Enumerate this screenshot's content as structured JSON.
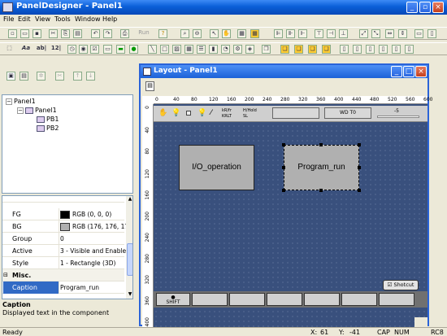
{
  "app": {
    "title": "PanelDesigner - Panel1"
  },
  "menu": [
    "File",
    "Edit",
    "View",
    "Tools",
    "Window",
    "Help"
  ],
  "toolbar": {
    "run_label": "Run",
    "text_a": "Aa",
    "text_ab": "ab|",
    "text_12": "12|"
  },
  "left_toolbar": {},
  "tree": {
    "root": "Panel1",
    "panel": "Panel1",
    "items": [
      "PB1",
      "PB2"
    ]
  },
  "props": {
    "rows": [
      {
        "key": "FG",
        "value": "RGB (0, 0, 0)",
        "color": "#000000"
      },
      {
        "key": "BG",
        "value": "RGB (176, 176, 176)",
        "color": "#b0b0b0"
      },
      {
        "key": "Group",
        "value": "0"
      },
      {
        "key": "Active",
        "value": "3 - Visible and Enabled"
      },
      {
        "key": "Style",
        "value": "1 - Rectangle (3D)"
      }
    ],
    "section": "Misc.",
    "selected": {
      "key": "Caption",
      "value": "Program_run"
    }
  },
  "help": {
    "title": "Caption",
    "text": "Displayed text in the component"
  },
  "status": {
    "ready": "Ready",
    "x": "X:",
    "x_val": "61",
    "y": "Y:",
    "y_val": "-41",
    "caps": "CAP",
    "num": "NUM",
    "rc": "RC8"
  },
  "layout": {
    "title": "Layout - Panel1",
    "ruler_top": [
      "0",
      "40",
      "80",
      "120",
      "160",
      "200",
      "240",
      "280",
      "320",
      "360",
      "400",
      "440",
      "480",
      "520",
      "560",
      "600"
    ],
    "ruler_left": [
      "0",
      "40",
      "80",
      "120",
      "160",
      "200",
      "240",
      "280",
      "320",
      "360",
      "400"
    ],
    "strip": {
      "label1": "WD T0",
      "label2": "-5",
      "tiny1": "kR/fr",
      "tiny2": "KRLT",
      "tiny3": "H/Hold",
      "tiny4": "SL"
    },
    "buttons": {
      "b1": "I/O_operation",
      "b2": "Program_run"
    },
    "shortcut": "Shotcut",
    "fkey_shift": "SHIFT"
  },
  "colors": {
    "accent": "#0a5fd8",
    "canvas": "#39507d",
    "selection": "#316ac5"
  }
}
